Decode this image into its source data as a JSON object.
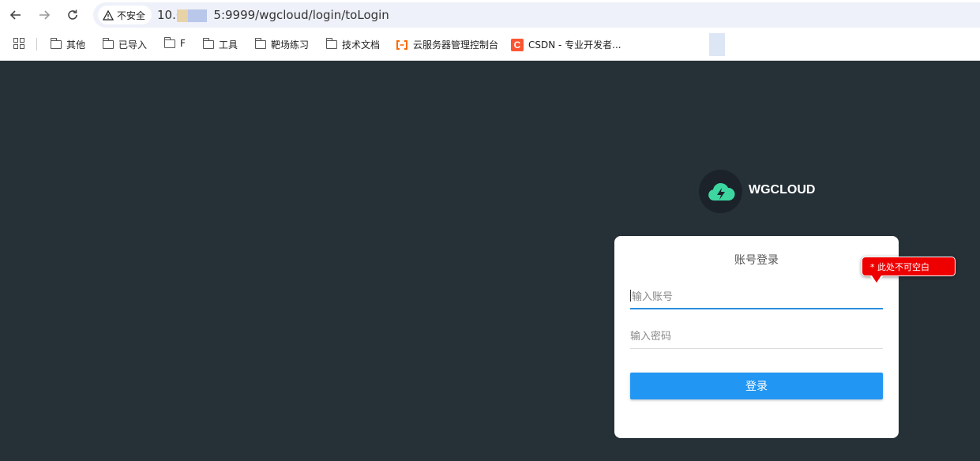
{
  "browser": {
    "security_label": "不安全",
    "url_prefix": "10.0",
    "url_suffix": "5:9999/wgcloud/login/toLogin"
  },
  "bookmarks": [
    {
      "label": "其他",
      "icon": "folder-icon"
    },
    {
      "label": "已导入",
      "icon": "folder-icon"
    },
    {
      "label": "F",
      "icon": "folder-icon"
    },
    {
      "label": "工具",
      "icon": "folder-icon"
    },
    {
      "label": "靶场练习",
      "icon": "folder-icon"
    },
    {
      "label": "技术文档",
      "icon": "folder-icon"
    },
    {
      "label": "云服务器管理控制台",
      "icon": "aliyun-icon"
    },
    {
      "label": "CSDN - 专业开发者...",
      "icon": "csdn-icon"
    }
  ],
  "app": {
    "brand": "WGCLOUD",
    "login_title": "账号登录",
    "account_placeholder": "输入账号",
    "password_placeholder": "输入密码",
    "login_button": "登录",
    "validation_message": "* 此处不可空白"
  },
  "colors": {
    "background": "#263137",
    "accent": "#2196f3",
    "logo": "#3dd6a0",
    "error": "#e00000"
  }
}
